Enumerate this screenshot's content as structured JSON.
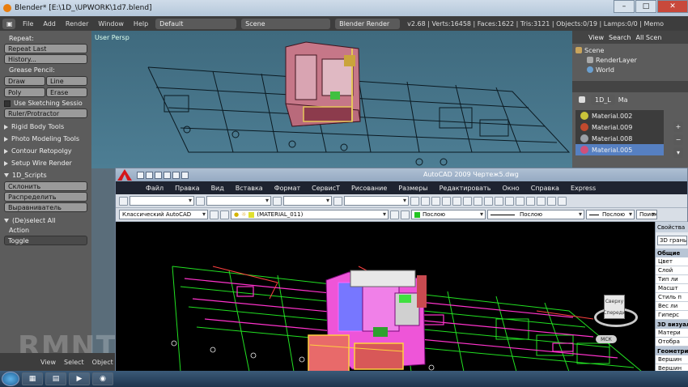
{
  "blender": {
    "title": "Blender* [E:\\1D_\\UPWORK\\1d7.blend]",
    "menu": [
      "File",
      "Add",
      "Render",
      "Window",
      "Help"
    ],
    "layout": "Default",
    "scene": "Scene",
    "engine": "Blender Render",
    "stats": "v2.68 | Verts:16458 | Faces:1622 | Tris:3121 | Objects:0/19 | Lamps:0/0 | Memo",
    "viewport_label": "User Persp",
    "left_panel": {
      "repeat_header": "Repeat:",
      "repeat_last": "Repeat Last",
      "history": "History...",
      "grease_header": "Grease Pencil:",
      "draw": "Draw",
      "line": "Line",
      "poly": "Poly",
      "erase": "Erase",
      "sketch": "Use Sketching Sessio",
      "ruler": "Ruler/Protractor",
      "sections": [
        "Rigid Body Tools",
        "Photo Modeling Tools",
        "Contour Retopolgy",
        "Setup Wire Render",
        "1D_Scripts"
      ],
      "sklonit": "Склонить",
      "raspredelit": "Распределить",
      "vyravnivatel": "Выравниватель",
      "deselect": "(De)select All",
      "action_label": "Action",
      "action_value": "Toggle"
    },
    "bottom_bar": [
      "View",
      "Select",
      "Object"
    ],
    "right_panel": {
      "view": "View",
      "search": "Search",
      "all_scenes": "All Scen",
      "scene": "Scene",
      "render_layer": "RenderLayer",
      "world": "World",
      "object": "1D_L",
      "ma": "Ma",
      "materials": [
        {
          "name": "Material.002",
          "color": "#c8c23a"
        },
        {
          "name": "Material.009",
          "color": "#c24a2e"
        },
        {
          "name": "Material.008",
          "color": "#9aa0a6"
        },
        {
          "name": "Material.005",
          "color": "#d0507a"
        }
      ]
    }
  },
  "autocad": {
    "title": "AutoCAD 2009 Чертеж5.dwg",
    "menu": [
      "Файл",
      "Правка",
      "Вид",
      "Вставка",
      "Формат",
      "СервисТ",
      "Рисование",
      "Размеры",
      "Редактировать",
      "Окно",
      "Справка",
      "Express"
    ],
    "workspace": "Классический AutoCAD",
    "layer": "(MATERIAL_011)",
    "color": "Послою",
    "linetype": "Послою",
    "lineweight": "Послою",
    "search": "Поиск",
    "properties": {
      "header": "Свойства",
      "selection": "3D грань",
      "general": "Общие",
      "general_rows": [
        "Цвет",
        "Слой",
        "Тип ли",
        "Масшт",
        "Стиль п",
        "Вес ли",
        "Гиперс"
      ],
      "viz": "3D визуал",
      "viz_rows": [
        "Матери",
        "Отобра"
      ],
      "geom": "Геометри",
      "geom_rows": [
        "Вершин",
        "Вершин"
      ]
    },
    "viewcube_top": "Сверху",
    "viewcube_front": "Спереди",
    "ucs": "МСК"
  },
  "watermark": "RMNT.RU",
  "colors": {
    "blender_bg": "#4d7e94",
    "acad_bg": "#000000",
    "acad_green": "#22e022",
    "acad_magenta": "#ff33cc"
  }
}
